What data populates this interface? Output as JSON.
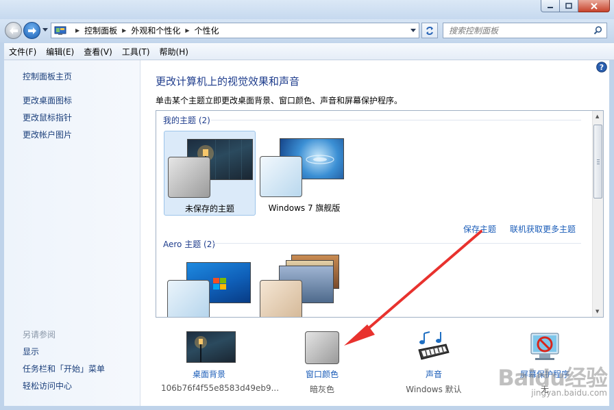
{
  "window": {
    "minimize_label": "minimize",
    "maximize_label": "maximize",
    "close_label": "close"
  },
  "address": {
    "crumbs": [
      "控制面板",
      "外观和个性化",
      "个性化"
    ]
  },
  "search": {
    "placeholder": "搜索控制面板"
  },
  "menu": {
    "items": [
      "文件(F)",
      "编辑(E)",
      "查看(V)",
      "工具(T)",
      "帮助(H)"
    ]
  },
  "sidebar": {
    "home": "控制面板主页",
    "links": [
      "更改桌面图标",
      "更改鼠标指针",
      "更改帐户图片"
    ],
    "see_also_title": "另请参阅",
    "see_also": [
      "显示",
      "任务栏和「开始」菜单",
      "轻松访问中心"
    ]
  },
  "main": {
    "title": "更改计算机上的视觉效果和声音",
    "description": "单击某个主题立即更改桌面背景、窗口颜色、声音和屏幕保护程序。",
    "my_themes_header": "我的主题 (2)",
    "my_themes": [
      {
        "label": "未保存的主题",
        "selected": true
      },
      {
        "label": "Windows 7 旗舰版",
        "selected": false
      }
    ],
    "save_theme_link": "保存主题",
    "get_more_link": "联机获取更多主题",
    "aero_header": "Aero 主题 (2)"
  },
  "settings": {
    "desktop_background": {
      "label": "桌面背景",
      "value": "106b76f4f55e8583d49eb9..."
    },
    "window_color": {
      "label": "窗口颜色",
      "value": "暗灰色"
    },
    "sounds": {
      "label": "声音",
      "value": "Windows 默认"
    },
    "screen_saver": {
      "label": "屏幕保护程序",
      "value": "无"
    }
  },
  "watermark": {
    "main": "Baidu经验",
    "sub": "jingyan.baidu.com"
  },
  "colors": {
    "link": "#1a5cb8",
    "title": "#1e3c8c",
    "annotation_arrow": "#e8322e",
    "selected_tile": "#dbeaf9"
  }
}
